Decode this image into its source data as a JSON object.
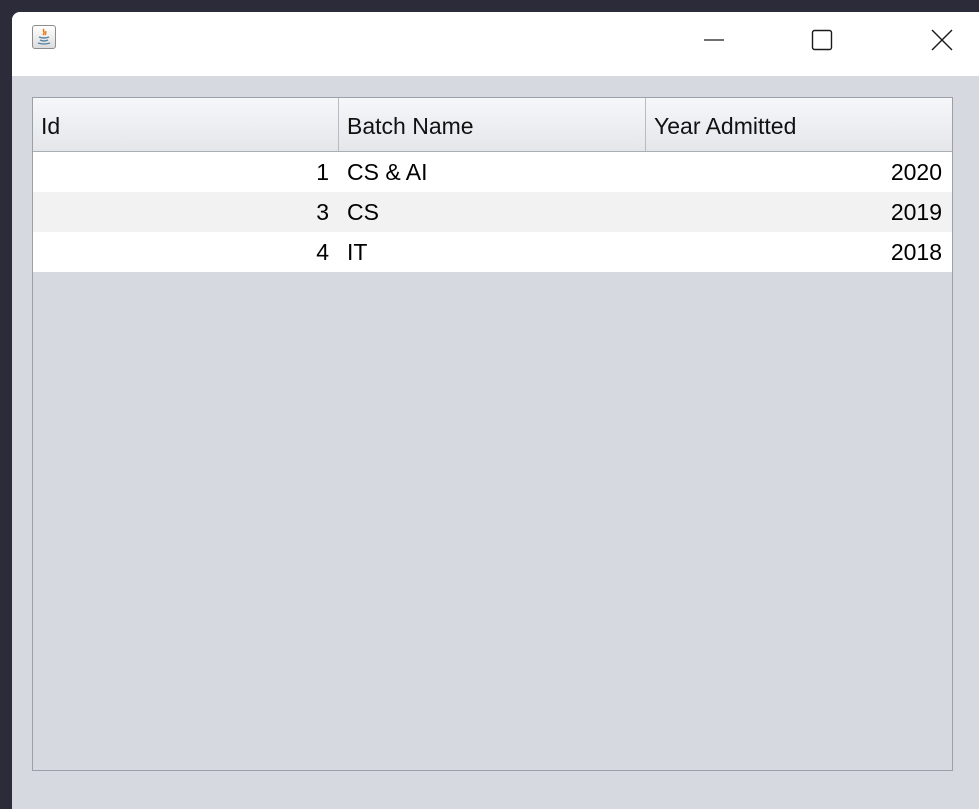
{
  "window": {
    "title": "",
    "icon": "java-icon",
    "controls": {
      "minimize": "minimize-icon",
      "maximize": "maximize-icon",
      "close": "close-icon"
    }
  },
  "table": {
    "columns": [
      "Id",
      "Batch Name",
      "Year Admitted"
    ],
    "rows": [
      {
        "id": "1",
        "batch_name": "CS & AI",
        "year_admitted": "2020"
      },
      {
        "id": "3",
        "batch_name": "CS",
        "year_admitted": "2019"
      },
      {
        "id": "4",
        "batch_name": "IT",
        "year_admitted": "2018"
      }
    ]
  },
  "colors": {
    "desktop": "#2c2b3a",
    "window_bg": "#d6d9e0",
    "row_odd": "#ffffff",
    "row_even": "#f2f2f2"
  }
}
